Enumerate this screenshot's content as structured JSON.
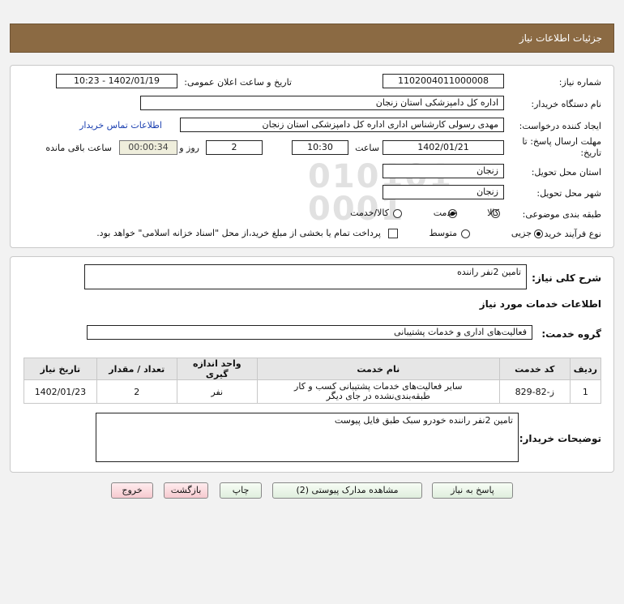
{
  "header": {
    "title": "جزئیات اطلاعات نیاز"
  },
  "fields": {
    "need_number_label": "شماره نیاز:",
    "need_number": "1102004011000008",
    "announce_label": "تاریخ و ساعت اعلان عمومی:",
    "announce_value": "1402/01/19 - 10:23",
    "buyer_org_label": "نام دستگاه خریدار:",
    "buyer_org": "اداره کل دامپزشکی استان زنجان",
    "creator_label": "ایجاد کننده درخواست:",
    "creator": "مهدی رسولی کارشناس اداری اداره کل دامپزشکی استان زنجان",
    "contact_link": "اطلاعات تماس خریدار",
    "deadline_label_1": "مهلت ارسال پاسخ: تا",
    "deadline_label_2": "تاریخ:",
    "deadline_date": "1402/01/21",
    "time_label": "ساعت",
    "deadline_time": "10:30",
    "days_value": "2",
    "days_label": "روز و",
    "remaining_time": "00:00:34",
    "remaining_label": "ساعت باقی مانده",
    "delivery_province_label": "استان محل تحویل:",
    "delivery_province": "زنجان",
    "delivery_city_label": "شهر محل تحویل:",
    "delivery_city": "زنجان",
    "category_label": "طبقه بندی موضوعی:",
    "category_options": [
      "کالا",
      "خدمت",
      "کالا/خدمت"
    ],
    "category_selected": "خدمت",
    "process_label": "نوع فرآیند خرید :",
    "process_options": [
      "جزیی",
      "متوسط"
    ],
    "process_selected": "جزیی",
    "treasury_text": "پرداخت تمام یا بخشی از مبلغ خرید،از محل \"اسناد خزانه اسلامی\" خواهد بود."
  },
  "summary": {
    "label": "شرح کلی نیاز:",
    "value": "تامین 2نفر راننده",
    "services_heading": "اطلاعات خدمات مورد نیاز",
    "service_group_label": "گروه خدمت:",
    "service_group": "فعالیت‌های اداری و خدمات پشتیبانی"
  },
  "table": {
    "headers": [
      "ردیف",
      "کد خدمت",
      "نام خدمت",
      "واحد اندازه گیری",
      "تعداد / مقدار",
      "تاریخ نیاز"
    ],
    "rows": [
      {
        "row": "1",
        "code": "ز-82-829",
        "name_1": "سایر فعالیت‌های خدمات پشتیبانی کسب و کار",
        "name_2": "طبقه‌بندی‌نشده در جای دیگر",
        "unit": "نفر",
        "qty": "2",
        "date": "1402/01/23"
      }
    ]
  },
  "buyer_notes": {
    "label": "توضیحات خریدار:",
    "value": "تامین 2نفر راننده خودرو سبک طبق فایل پیوست"
  },
  "buttons": {
    "reply": "پاسخ به نیاز",
    "attachments": "مشاهده مدارک پیوستی (2)",
    "print": "چاپ",
    "back": "بازگشت",
    "exit": "خروج"
  },
  "colors": {
    "header_bg": "#8b6a43",
    "link": "#1a3fb0",
    "exit_button": "#f6c9cf"
  }
}
